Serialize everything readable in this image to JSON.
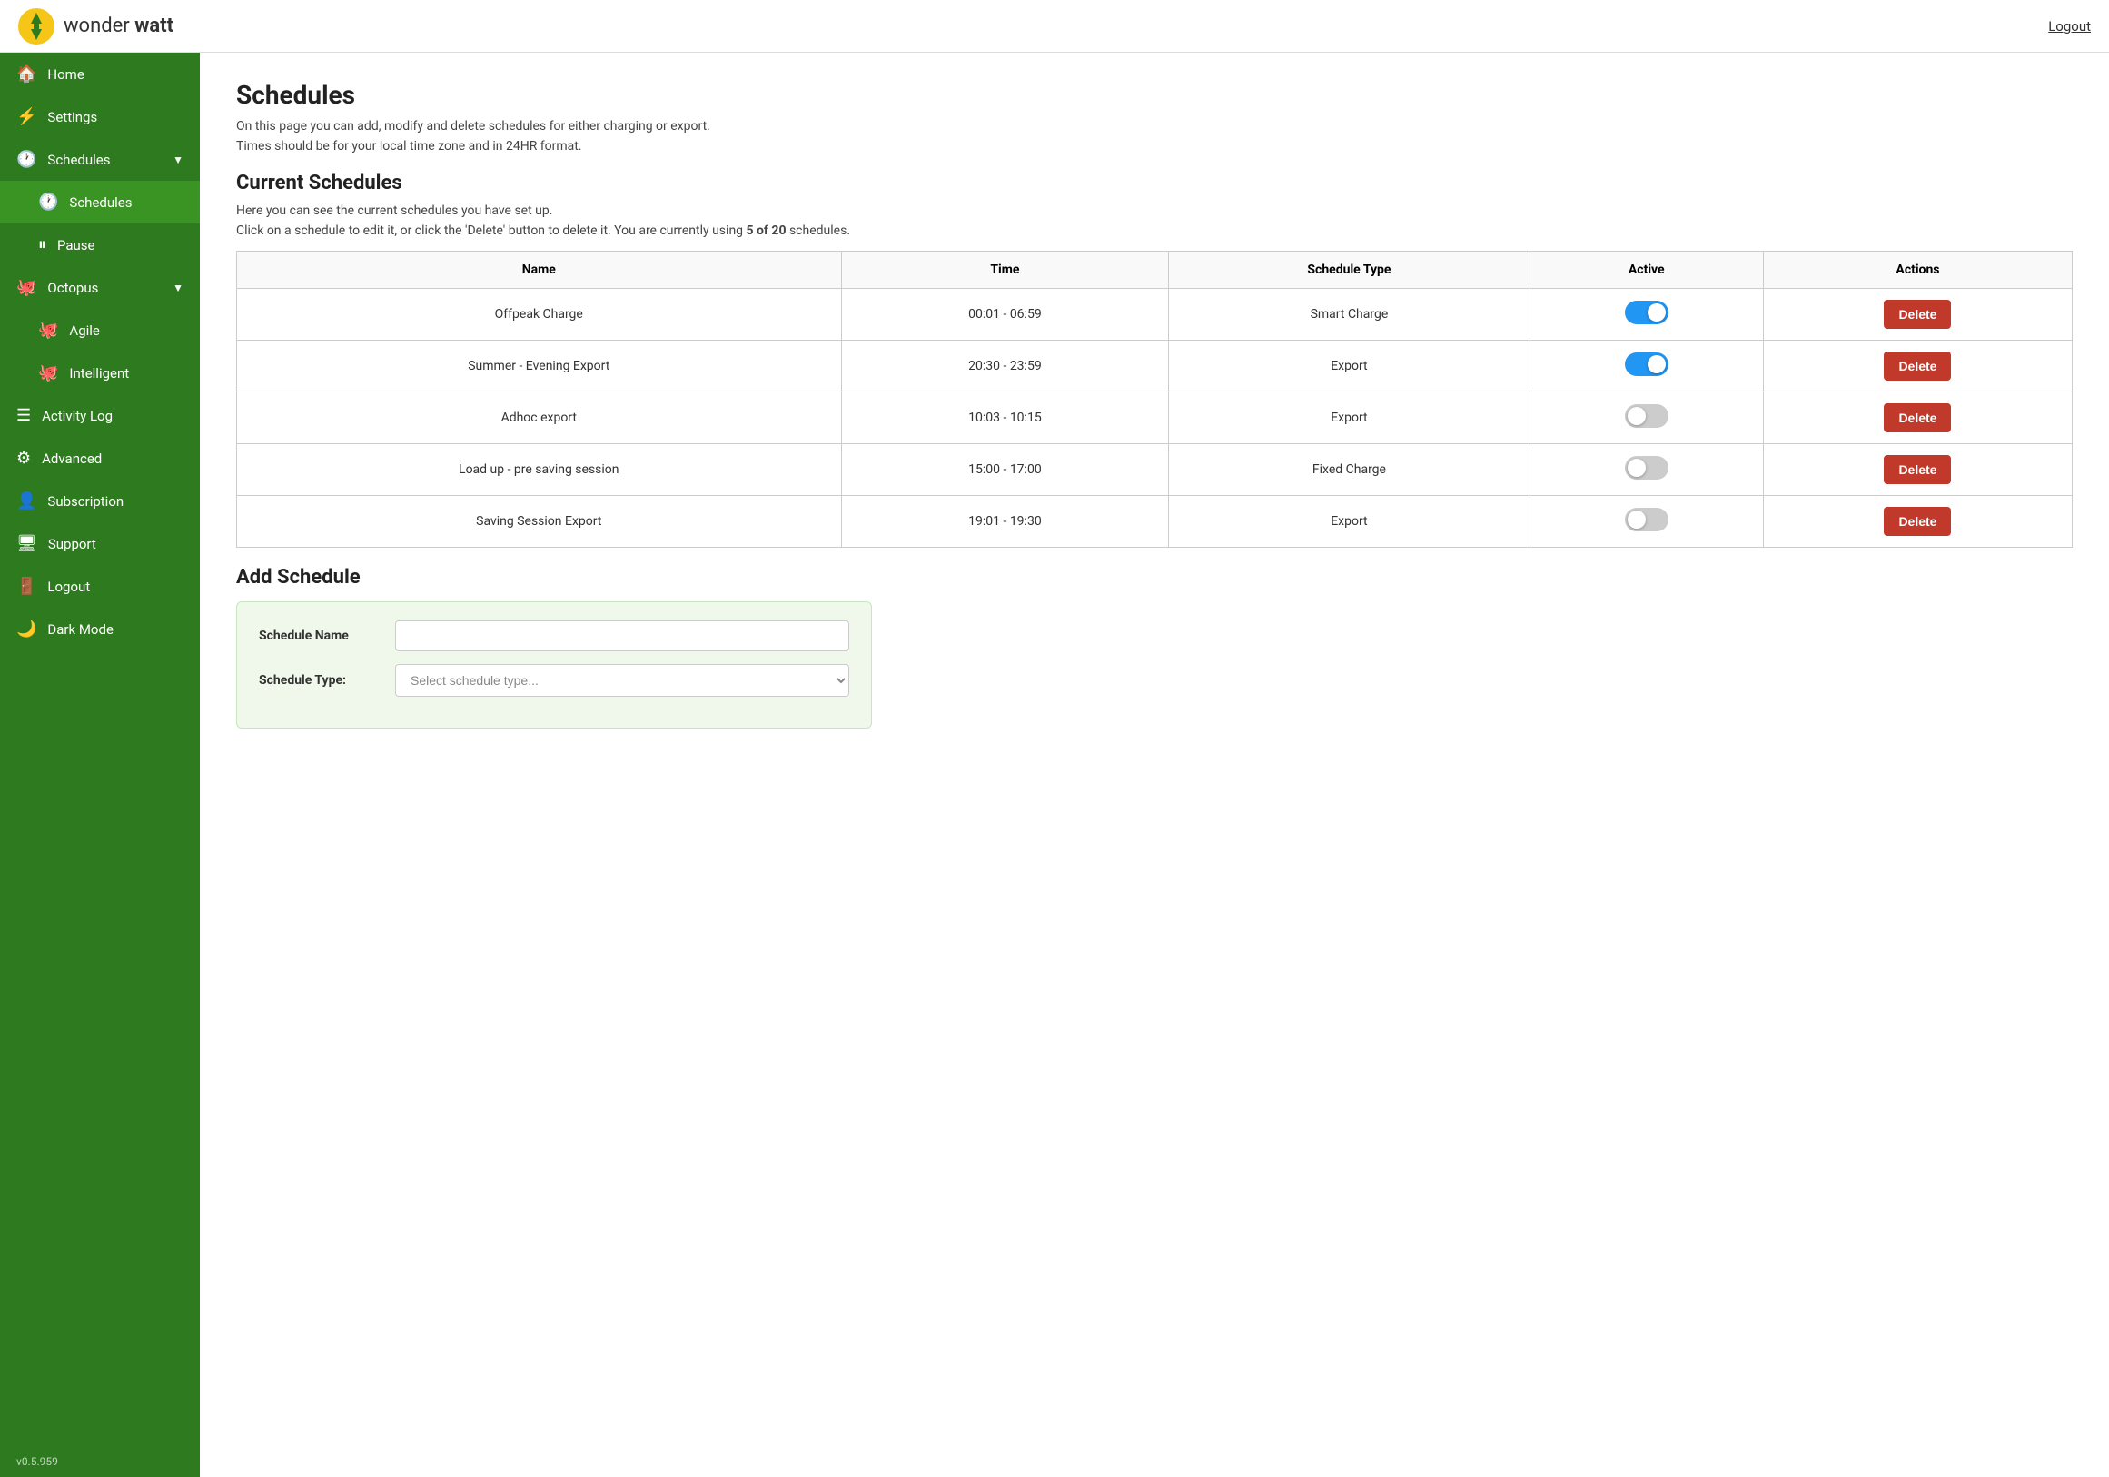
{
  "header": {
    "logo_text_light": "wonder ",
    "logo_text_bold": "watt",
    "logout_label": "Logout"
  },
  "sidebar": {
    "items": [
      {
        "id": "home",
        "label": "Home",
        "icon": "🏠",
        "active": false,
        "indent": false
      },
      {
        "id": "settings",
        "label": "Settings",
        "icon": "⚡",
        "active": false,
        "indent": false
      },
      {
        "id": "schedules-parent",
        "label": "Schedules",
        "icon": "🕐",
        "active": false,
        "indent": false,
        "has_chevron": true
      },
      {
        "id": "schedules-child",
        "label": "Schedules",
        "icon": "🕐",
        "active": true,
        "indent": true
      },
      {
        "id": "pause",
        "label": "Pause",
        "icon": "⏸",
        "active": false,
        "indent": true
      },
      {
        "id": "octopus",
        "label": "Octopus",
        "icon": "🐙",
        "active": false,
        "indent": false,
        "has_chevron": true
      },
      {
        "id": "agile",
        "label": "Agile",
        "icon": "🐙",
        "active": false,
        "indent": true
      },
      {
        "id": "intelligent",
        "label": "Intelligent",
        "icon": "🐙",
        "active": false,
        "indent": true
      },
      {
        "id": "activity-log",
        "label": "Activity Log",
        "icon": "☰",
        "active": false,
        "indent": false
      },
      {
        "id": "advanced",
        "label": "Advanced",
        "icon": "⚙",
        "active": false,
        "indent": false
      },
      {
        "id": "subscription",
        "label": "Subscription",
        "icon": "👤",
        "active": false,
        "indent": false
      },
      {
        "id": "support",
        "label": "Support",
        "icon": "🖥",
        "active": false,
        "indent": false
      },
      {
        "id": "logout",
        "label": "Logout",
        "icon": "🚪",
        "active": false,
        "indent": false
      },
      {
        "id": "dark-mode",
        "label": "Dark Mode",
        "icon": "🌙",
        "active": false,
        "indent": false
      }
    ],
    "version": "v0.5.959"
  },
  "page": {
    "title": "Schedules",
    "desc1": "On this page you can add, modify and delete schedules for either charging or export.",
    "desc2": "Times should be for your local time zone and in 24HR format.",
    "current_schedules_title": "Current Schedules",
    "current_desc1": "Here you can see the current schedules you have set up.",
    "current_desc2_pre": "Click on a schedule to edit it, or click the 'Delete' button to delete it. You are currently using ",
    "schedule_count": "5 of 20",
    "current_desc2_post": " schedules.",
    "add_schedule_title": "Add Schedule",
    "table": {
      "headers": [
        "Name",
        "Time",
        "Schedule Type",
        "Active",
        "Actions"
      ],
      "rows": [
        {
          "name": "Offpeak Charge",
          "time": "00:01 - 06:59",
          "type": "Smart Charge",
          "active": true
        },
        {
          "name": "Summer - Evening Export",
          "time": "20:30 - 23:59",
          "type": "Export",
          "active": true
        },
        {
          "name": "Adhoc export",
          "time": "10:03 - 10:15",
          "type": "Export",
          "active": false
        },
        {
          "name": "Load up - pre saving session",
          "time": "15:00 - 17:00",
          "type": "Fixed Charge",
          "active": false
        },
        {
          "name": "Saving Session Export",
          "time": "19:01 - 19:30",
          "type": "Export",
          "active": false
        }
      ],
      "delete_label": "Delete"
    },
    "form": {
      "name_label": "Schedule Name",
      "name_placeholder": "",
      "type_label": "Schedule Type:",
      "type_placeholder": "Select schedule type..."
    }
  }
}
